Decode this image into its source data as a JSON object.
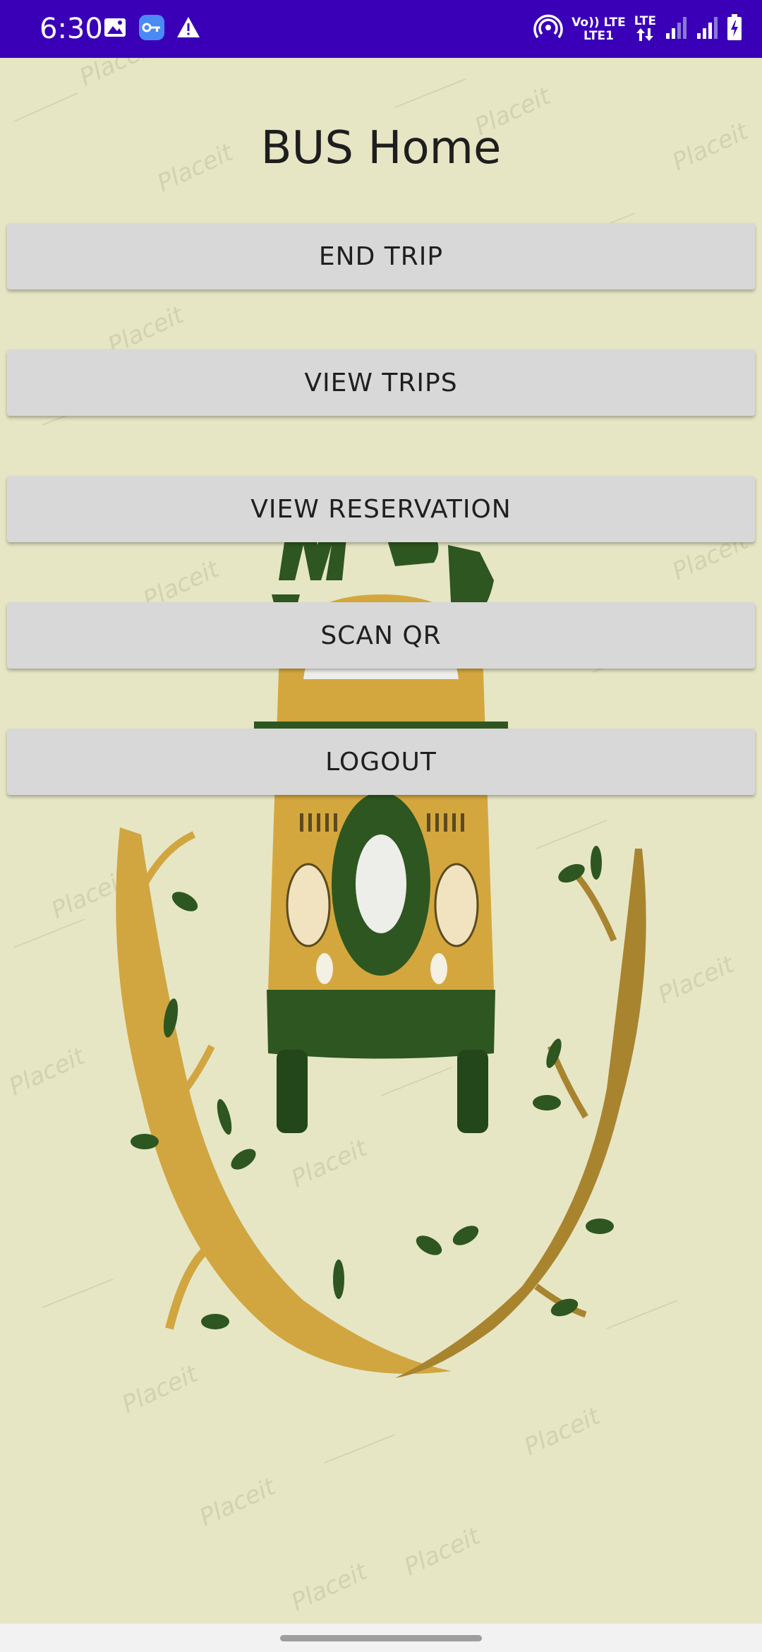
{
  "status_bar": {
    "time": "6:30",
    "left_icons": [
      "image-icon",
      "vpn-key-icon",
      "warning-icon"
    ],
    "network_top": "Vo)) LTE",
    "network_bottom": "LTE1",
    "lte_label": "LTE",
    "right_icons": [
      "hotspot-icon",
      "data-arrows-icon",
      "signal-icon",
      "signal-icon",
      "battery-charging-icon"
    ],
    "background_color": "#3a00b8"
  },
  "app": {
    "title": "BUS Home",
    "background_color": "#e6e6c5",
    "watermark_text": "Placeit",
    "buttons": [
      {
        "name": "end-trip-button",
        "label": "END TRIP"
      },
      {
        "name": "view-trips-button",
        "label": "VIEW TRIPS"
      },
      {
        "name": "view-reservation-button",
        "label": "VIEW RESERVATION"
      },
      {
        "name": "scan-qr-button",
        "label": "SCAN QR"
      },
      {
        "name": "logout-button",
        "label": "LOGOUT"
      }
    ],
    "logo_text": "MY BUS"
  },
  "colors": {
    "button_bg": "#d8d8d8",
    "logo_green": "#2e5620",
    "logo_gold": "#d4a73e"
  }
}
